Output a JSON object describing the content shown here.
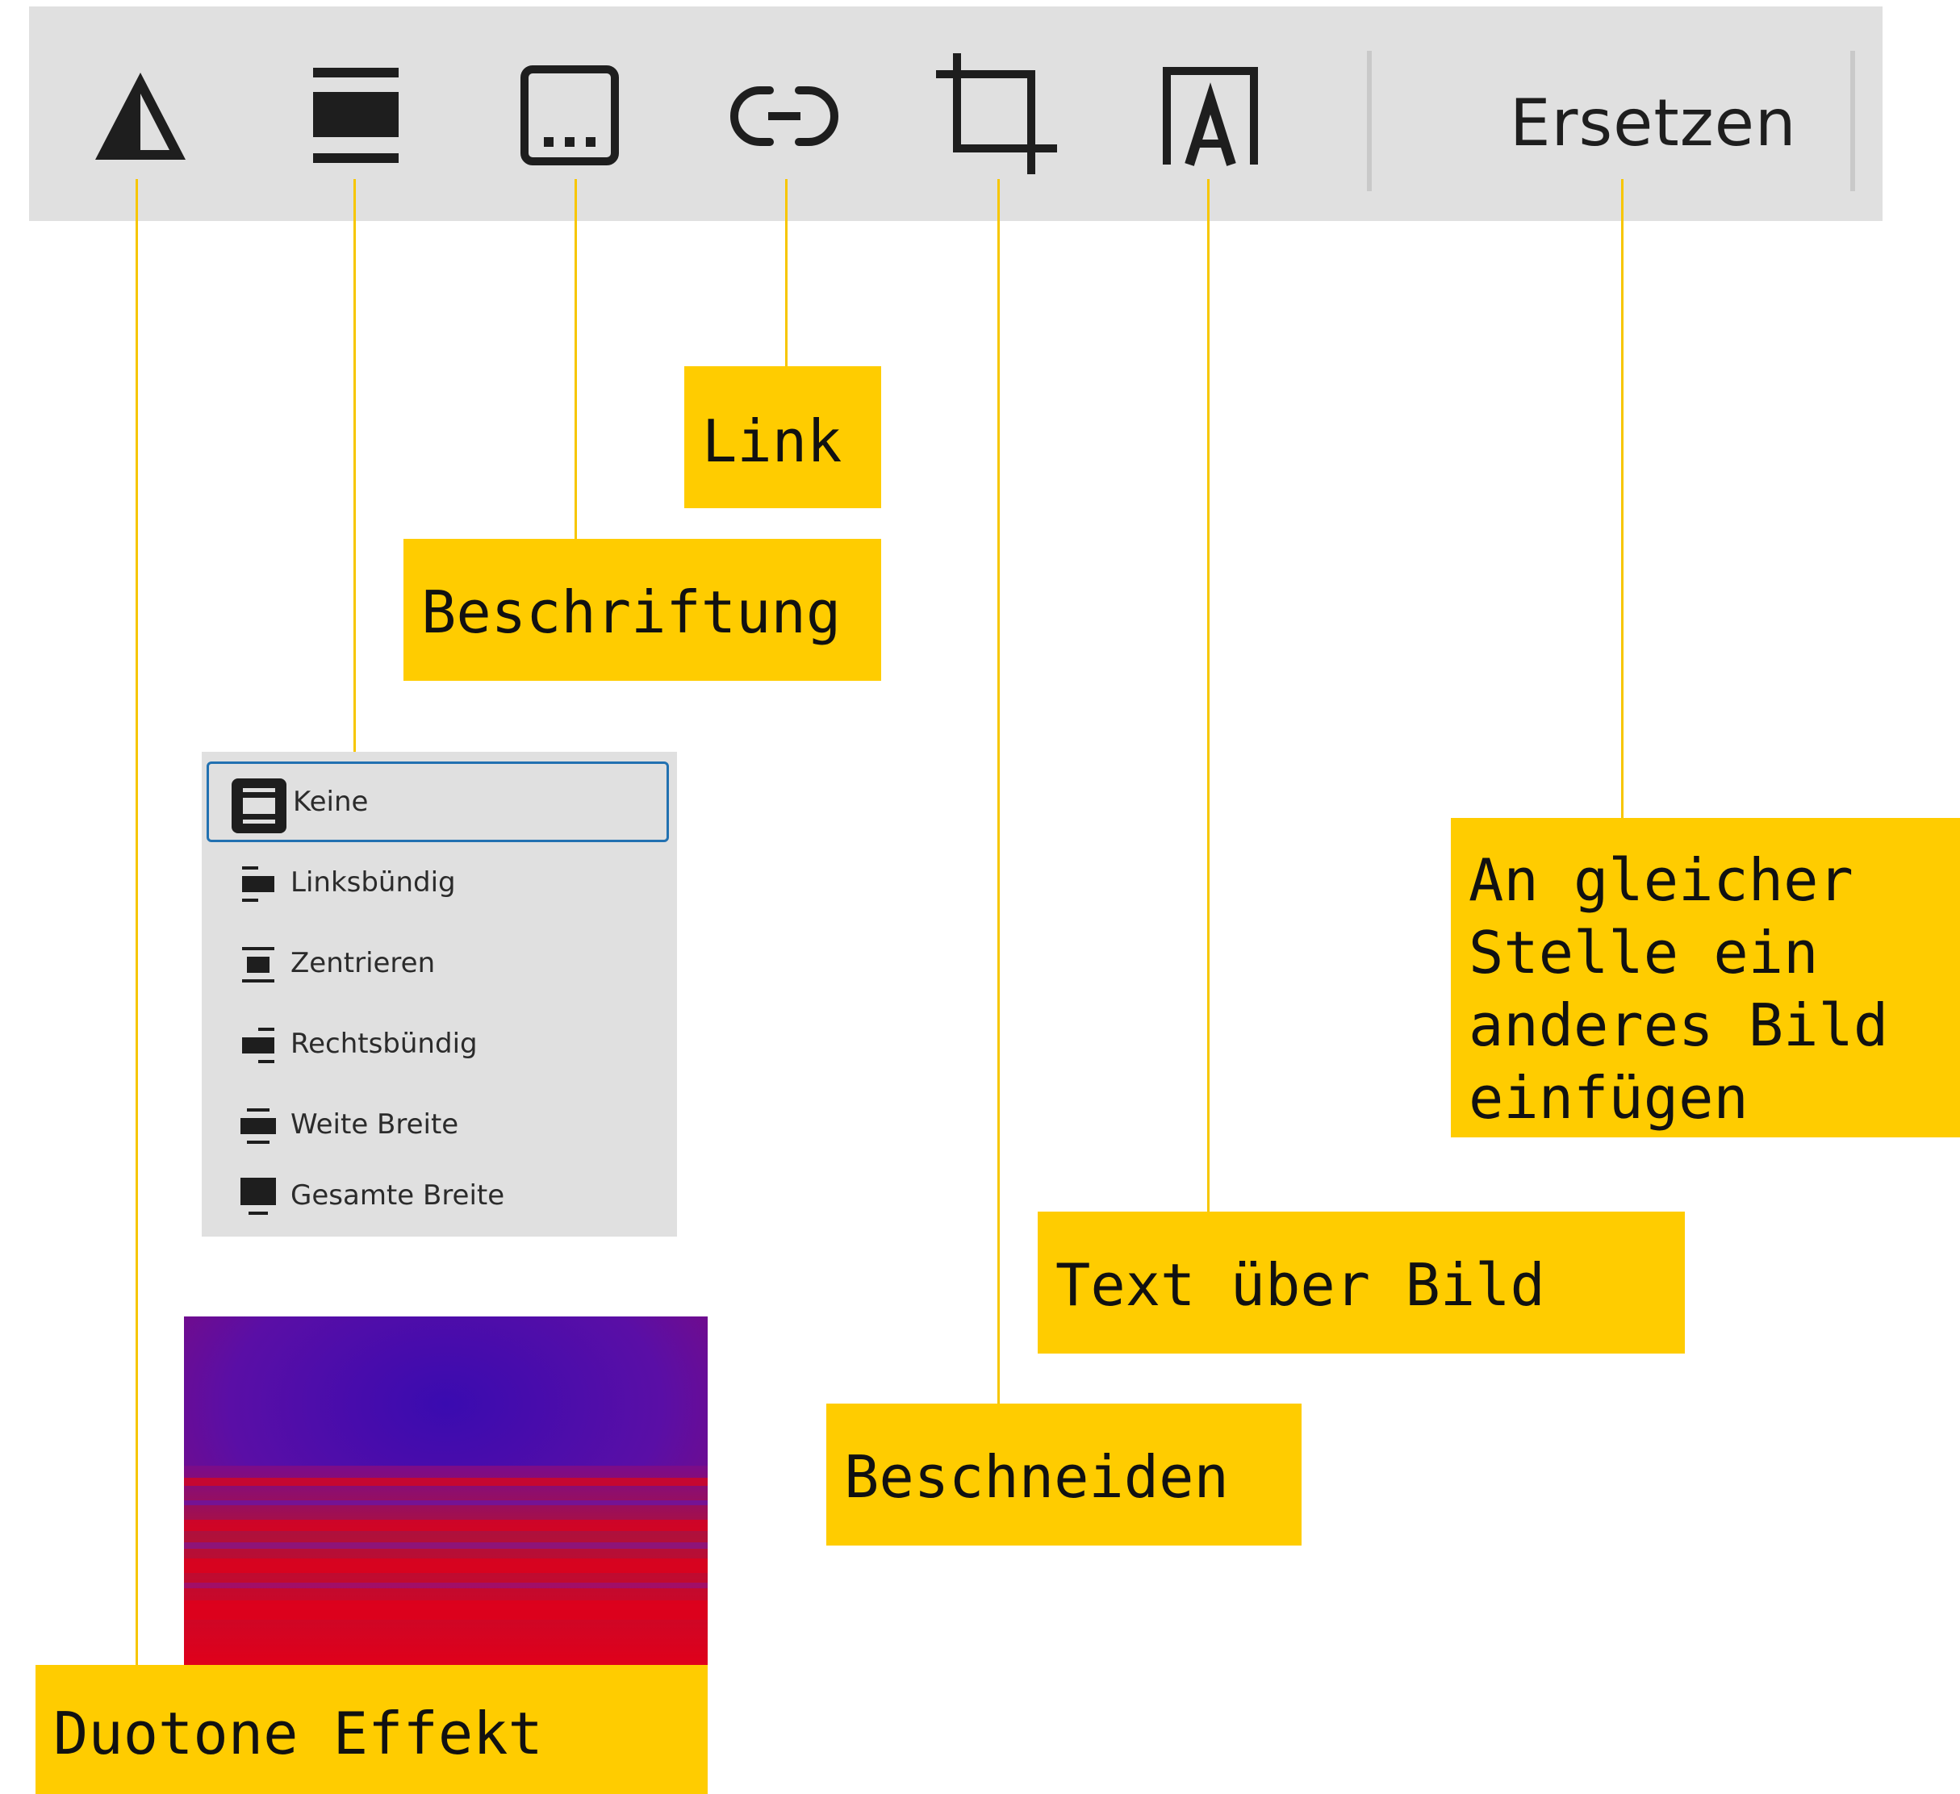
{
  "toolbar": {
    "icons": [
      "duotone-icon",
      "align-icon",
      "caption-icon",
      "link-icon",
      "crop-icon",
      "text-over-image-icon"
    ],
    "replace_label": "Ersetzen",
    "background": "#e0e0e0"
  },
  "align_menu": {
    "items": [
      {
        "label": "Keine",
        "icon": "align-none-icon",
        "selected": true
      },
      {
        "label": "Linksbündig",
        "icon": "align-left-icon",
        "selected": false
      },
      {
        "label": "Zentrieren",
        "icon": "align-center-icon",
        "selected": false
      },
      {
        "label": "Rechtsbündig",
        "icon": "align-right-icon",
        "selected": false
      },
      {
        "label": "Weite Breite",
        "icon": "align-wide-icon",
        "selected": false
      },
      {
        "label": "Gesamte Breite",
        "icon": "align-full-icon",
        "selected": false
      }
    ],
    "selected_border_color": "#2271b1"
  },
  "callouts": {
    "link": "Link",
    "caption": "Beschriftung",
    "replace": "An gleicher\nStelle ein\nanderes Bild\neinfügen",
    "text_over_image": "Text über Bild",
    "crop": "Beschneiden",
    "duotone": "Duotone Effekt"
  },
  "colors": {
    "callout": "#ffcc00",
    "leader": "#f7c600",
    "duotone_dark": "#3a0bb0",
    "duotone_light": "#e0001a"
  }
}
